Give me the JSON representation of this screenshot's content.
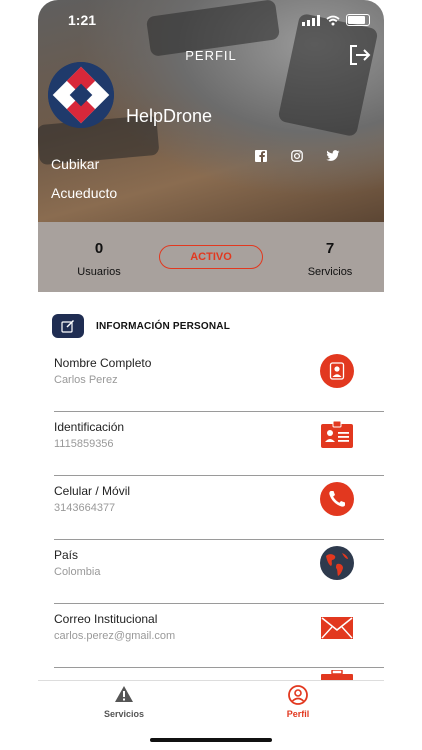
{
  "status_bar": {
    "time": "1:21"
  },
  "header": {
    "title": "PERFIL",
    "company_name": "HelpDrone",
    "lines": [
      "Cubikar",
      "Acueducto"
    ],
    "social": [
      "facebook-icon",
      "instagram-icon",
      "twitter-icon"
    ]
  },
  "stats": {
    "users_count": "0",
    "users_label": "Usuarios",
    "status_badge": "ACTIVO",
    "services_count": "7",
    "services_label": "Servicios"
  },
  "section": {
    "title": "INFORMACIÓN PERSONAL"
  },
  "fields": [
    {
      "label": "Nombre Completo",
      "value": "Carlos Perez",
      "icon": "person-icon"
    },
    {
      "label": "Identificación",
      "value": "1115859356",
      "icon": "id-card-icon"
    },
    {
      "label": "Celular / Móvil",
      "value": "3143664377",
      "icon": "phone-icon"
    },
    {
      "label": "País",
      "value": "Colombia",
      "icon": "globe-icon"
    },
    {
      "label": "Correo Institucional",
      "value": "carlos.perez@gmail.com",
      "icon": "mail-icon"
    }
  ],
  "tabs": [
    {
      "label": "Servicios",
      "icon": "warning-icon",
      "active": false
    },
    {
      "label": "Perfil",
      "icon": "user-circle-icon",
      "active": true
    }
  ],
  "colors": {
    "accent": "#e2381f",
    "navy": "#1f2d52",
    "stats_bg": "#a8a19d"
  }
}
